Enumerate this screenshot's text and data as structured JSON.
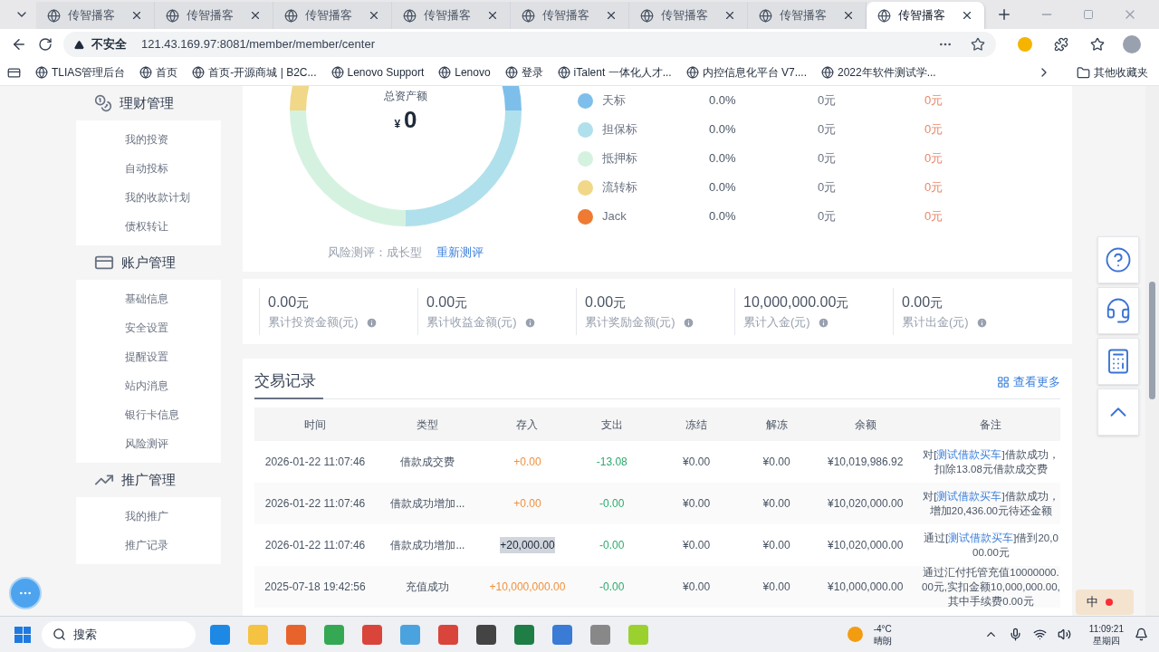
{
  "browser": {
    "tabs": [
      {
        "title": "传智播客",
        "selected": false
      },
      {
        "title": "传智播客",
        "selected": false
      },
      {
        "title": "传智播客",
        "selected": false
      },
      {
        "title": "传智播客",
        "selected": false
      },
      {
        "title": "传智播客",
        "selected": false
      },
      {
        "title": "传智播客",
        "selected": false
      },
      {
        "title": "传智播客",
        "selected": false
      },
      {
        "title": "传智播客",
        "selected": true
      }
    ],
    "security": "不安全",
    "url": "121.43.169.97:8081/member/member/center",
    "bookmarks": [
      {
        "label": "TLIAS管理后台"
      },
      {
        "label": "首页"
      },
      {
        "label": "首页-开源商城 | B2C..."
      },
      {
        "label": "Lenovo Support"
      },
      {
        "label": "Lenovo"
      },
      {
        "label": "登录"
      },
      {
        "label": "iTalent 一体化人才..."
      },
      {
        "label": "内控信息化平台 V7...."
      },
      {
        "label": "2022年软件测试学..."
      }
    ],
    "other_bookmarks": "其他收藏夹"
  },
  "sidebar": {
    "sections": [
      {
        "kind": "finance",
        "title": "理财管理",
        "items": [
          {
            "label": "我的投资"
          },
          {
            "label": "自动投标"
          },
          {
            "label": "我的收款计划"
          },
          {
            "label": "债权转让"
          }
        ]
      },
      {
        "kind": "account",
        "title": "账户管理",
        "items": [
          {
            "label": "基础信息"
          },
          {
            "label": "安全设置"
          },
          {
            "label": "提醒设置"
          },
          {
            "label": "站内消息"
          },
          {
            "label": "银行卡信息"
          },
          {
            "label": "风险测评"
          }
        ]
      },
      {
        "kind": "promo",
        "title": "推广管理",
        "items": [
          {
            "label": "我的推广"
          },
          {
            "label": "推广记录"
          }
        ]
      }
    ]
  },
  "assets": {
    "label": "总资产额",
    "currency": "¥",
    "amount": "0",
    "risk_label": "风险测评：成长型",
    "risk_action": "重新测评"
  },
  "legend": [
    {
      "name": "天标",
      "color": "#7dbfea",
      "percent": "0.0%",
      "amount": "0元",
      "income": "0元"
    },
    {
      "name": "担保标",
      "color": "#b0e0ec",
      "percent": "0.0%",
      "amount": "0元",
      "income": "0元"
    },
    {
      "name": "抵押标",
      "color": "#d5f2e0",
      "percent": "0.0%",
      "amount": "0元",
      "income": "0元"
    },
    {
      "name": "流转标",
      "color": "#f0d888",
      "percent": "0.0%",
      "amount": "0元",
      "income": "0元"
    },
    {
      "name": "Jack",
      "color": "#ef7a32",
      "percent": "0.0%",
      "amount": "0元",
      "income": "0元"
    }
  ],
  "stats": [
    {
      "value": "0.00",
      "unit": "元",
      "label": "累计投资金额(元)"
    },
    {
      "value": "0.00",
      "unit": "元",
      "label": "累计收益金额(元)"
    },
    {
      "value": "0.00",
      "unit": "元",
      "label": "累计奖励金额(元)"
    },
    {
      "value": "10,000,000.00",
      "unit": "元",
      "label": "累计入金(元)"
    },
    {
      "value": "0.00",
      "unit": "元",
      "label": "累计出金(元)"
    }
  ],
  "transactions": {
    "title": "交易记录",
    "more": "查看更多",
    "columns": [
      "时间",
      "类型",
      "存入",
      "支出",
      "冻结",
      "解冻",
      "余额",
      "备注"
    ],
    "rows": [
      {
        "time": "2026-01-22 11:07:46",
        "type": "借款成交费",
        "deposit": "+0.00",
        "highlighted": false,
        "expense": "-13.08",
        "frozen": "¥0.00",
        "unfrozen": "¥0.00",
        "balance": "¥10,019,986.92",
        "remark": {
          "before": "对[",
          "link": "测试借款买车",
          "after": "]借款成功，扣除13.08元借款成交费"
        }
      },
      {
        "time": "2026-01-22 11:07:46",
        "type": "借款成功增加...",
        "deposit": "+0.00",
        "highlighted": false,
        "expense": "-0.00",
        "frozen": "¥0.00",
        "unfrozen": "¥0.00",
        "balance": "¥10,020,000.00",
        "remark": {
          "before": "对[",
          "link": "测试借款买车",
          "after": "]借款成功，增加20,436.00元待还金额"
        }
      },
      {
        "time": "2026-01-22 11:07:46",
        "type": "借款成功增加...",
        "deposit": "+20,000.00",
        "highlighted": true,
        "expense": "-0.00",
        "frozen": "¥0.00",
        "unfrozen": "¥0.00",
        "balance": "¥10,020,000.00",
        "remark": {
          "before": "通过[",
          "link": "测试借款买车",
          "after": "]借到20,000.00元"
        }
      },
      {
        "time": "2025-07-18 19:42:56",
        "type": "充值成功",
        "deposit": "+10,000,000.00",
        "highlighted": false,
        "expense": "-0.00",
        "frozen": "¥0.00",
        "unfrozen": "¥0.00",
        "balance": "¥10,000,000.00",
        "remark": {
          "before": "通过汇付托管充值10000000.00元,实扣金额10,000,000.00,其中手续费0.00元"
        }
      }
    ]
  },
  "ime": "中",
  "taskbar": {
    "search": "搜索",
    "temperature": "-4°C",
    "weather": "晴朗",
    "time": "11:09:21",
    "day": "星期四"
  }
}
